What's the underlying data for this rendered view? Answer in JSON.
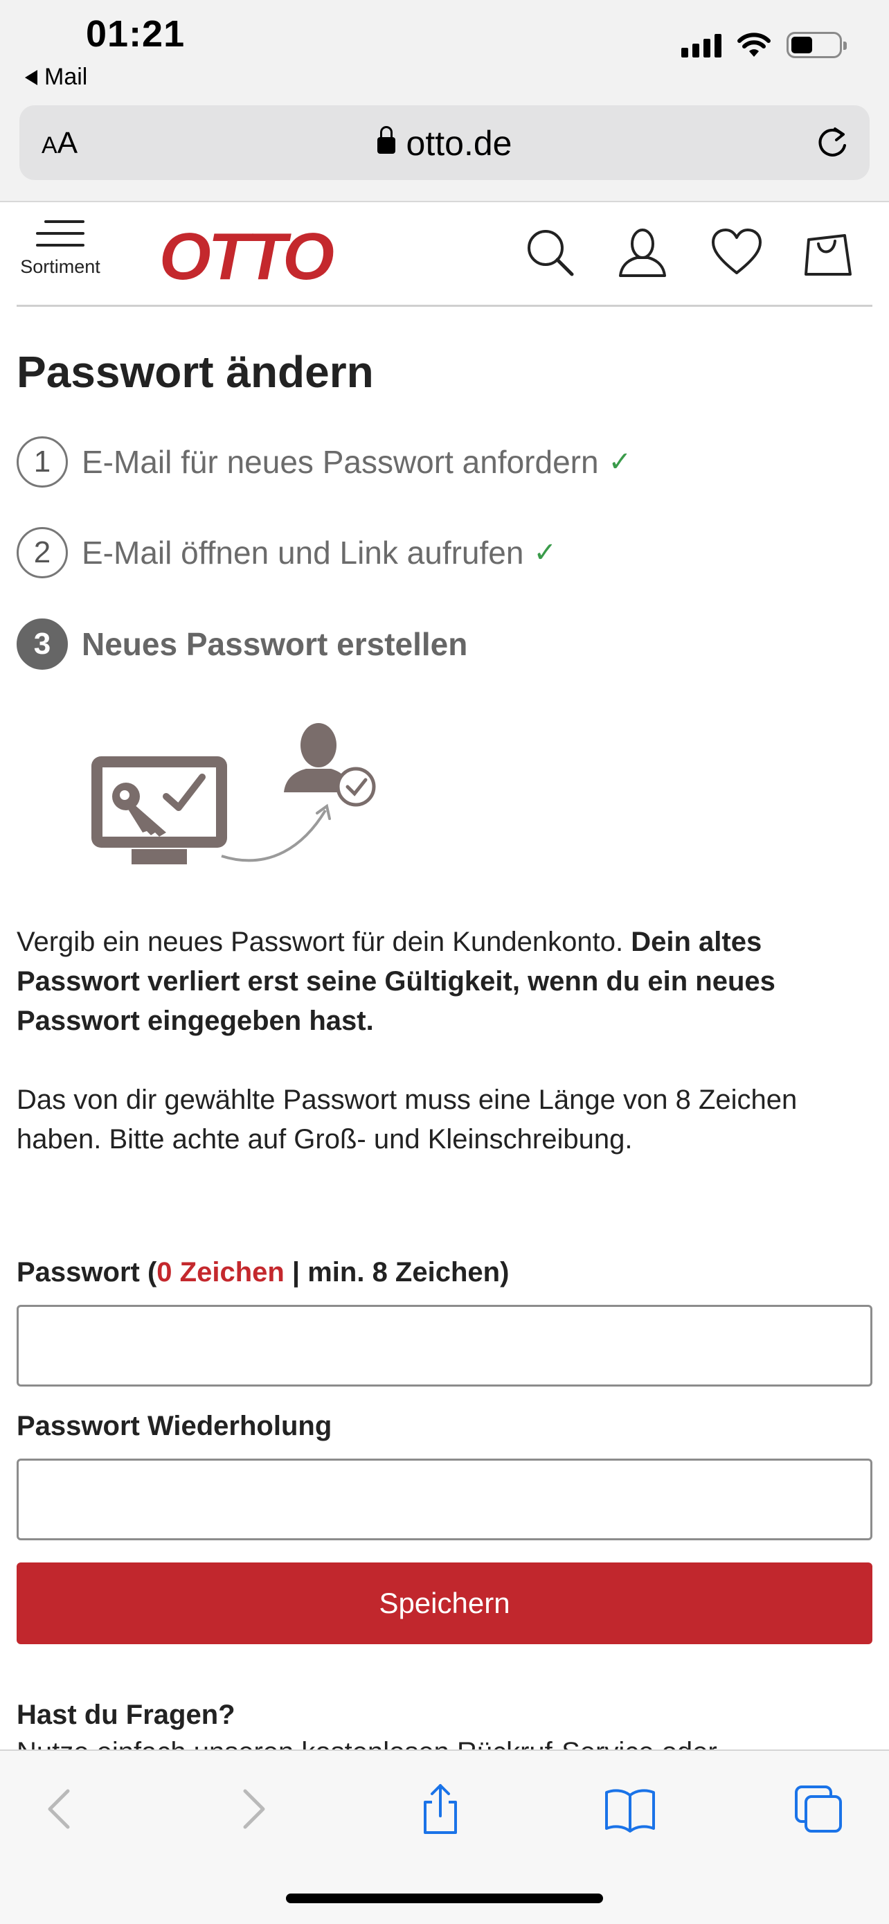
{
  "status_bar": {
    "time": "01:21",
    "back_label": "Mail"
  },
  "browser": {
    "text_size_label_small": "A",
    "text_size_label_large": "A",
    "url": "otto.de"
  },
  "header": {
    "menu_label": "Sortiment",
    "logo_text": "OTTO",
    "brand_color": "#c4282d"
  },
  "main": {
    "title": "Passwort ändern",
    "steps": [
      {
        "number": "1",
        "label": "E-Mail für neues Passwort anfordern",
        "done": true
      },
      {
        "number": "2",
        "label": "E-Mail öffnen und Link aufrufen",
        "done": true
      },
      {
        "number": "3",
        "label": "Neues Passwort erstellen",
        "done": false
      }
    ],
    "check_glyph": "✓",
    "intro_plain": "Vergib ein neues Passwort für dein Kundenkonto. ",
    "intro_bold": "Dein altes Passwort verliert erst seine Gültigkeit, wenn du ein neues Passwort eingegeben hast.",
    "requirement_text": "Das von dir gewählte Passwort muss eine Länge von 8 Zeichen haben. Bitte achte auf Groß- und Kleinschreibung.",
    "password_label_prefix": "Passwort (",
    "password_char_count": "0 Zeichen",
    "password_label_suffix": " | min. 8 Zeichen)",
    "password_value": "",
    "password_repeat_label": "Passwort Wiederholung",
    "password_repeat_value": "",
    "save_label": "Speichern",
    "faq_title": "Hast du Fragen?",
    "faq_text": "Nutze einfach unseren kostenlosen Rückruf-Service oder"
  },
  "toolbar": {
    "icons": [
      "back-icon",
      "forward-icon",
      "share-icon",
      "bookmarks-icon",
      "tabs-icon"
    ]
  }
}
